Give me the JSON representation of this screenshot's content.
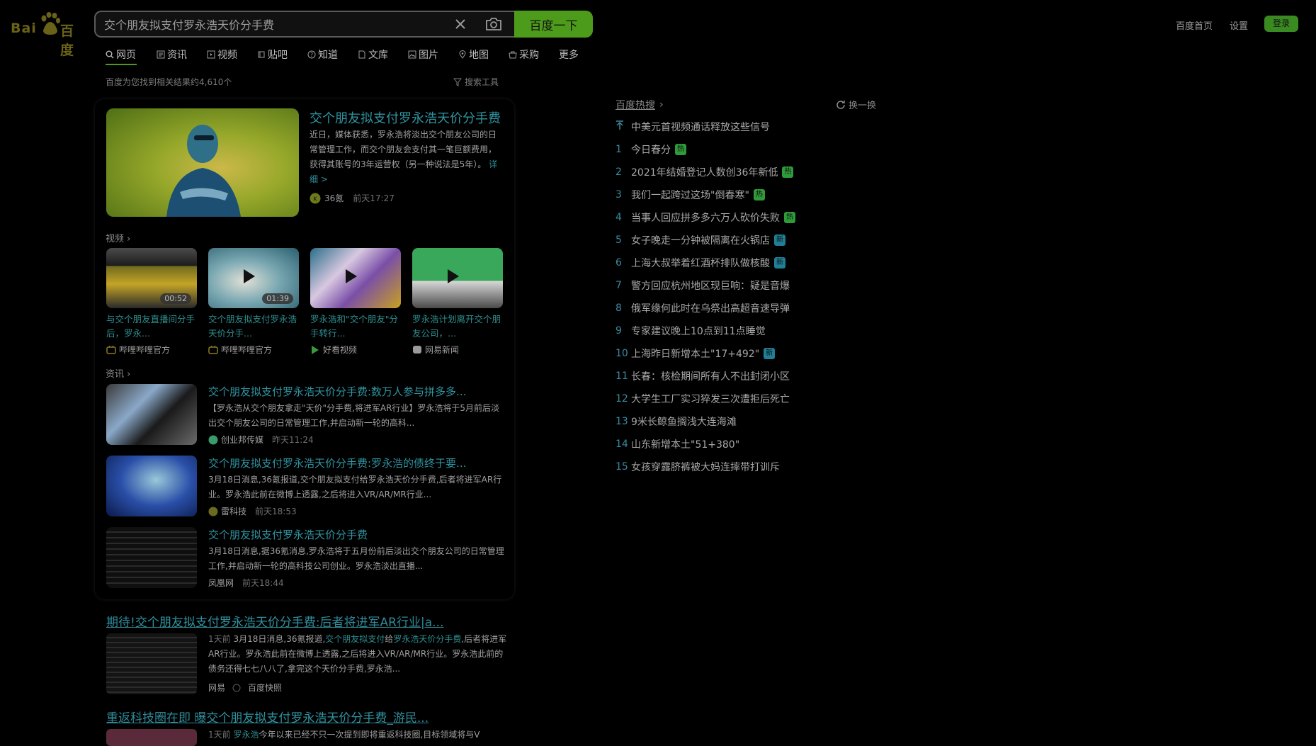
{
  "logo": {
    "text": "Bai",
    "text2": "百度"
  },
  "search": {
    "value": "交个朋友拟支付罗永浩天价分手费",
    "button_label": "百度一下"
  },
  "top_nav": {
    "home": "百度首页",
    "settings": "设置",
    "login": "登录"
  },
  "tabs": [
    {
      "label": "网页",
      "icon": "search-icon"
    },
    {
      "label": "资讯",
      "icon": "news-icon"
    },
    {
      "label": "视频",
      "icon": "video-icon"
    },
    {
      "label": "贴吧",
      "icon": "tieba-icon"
    },
    {
      "label": "知道",
      "icon": "question-icon"
    },
    {
      "label": "文库",
      "icon": "document-icon"
    },
    {
      "label": "图片",
      "icon": "image-icon"
    },
    {
      "label": "地图",
      "icon": "map-pin-icon"
    },
    {
      "label": "采购",
      "icon": "shop-icon"
    },
    {
      "label": "更多",
      "icon": ""
    }
  ],
  "result_count": "百度为您找到相关结果约4,610个",
  "search_tools": "搜索工具",
  "featured": {
    "title": "交个朋友拟支付罗永浩天价分手费",
    "desc": "近日，媒体获悉，罗永浩将淡出交个朋友公司的日常管理工作，而交个朋友会支付其一笔巨额费用，获得其账号的3年运营权（另一种说法是5年）。",
    "more": "详细 >",
    "source": "36氪",
    "time": "前天17:27"
  },
  "video_section": "视频",
  "videos": [
    {
      "title": "与交个朋友直播间分手后，罗永...",
      "source": "哔哩哔哩官方",
      "duration": "00:52"
    },
    {
      "title": "交个朋友拟支付罗永浩天价分手...",
      "source": "哔哩哔哩官方",
      "duration": "01:39"
    },
    {
      "title": "罗永浩和\"交个朋友\"分手转行...",
      "source": "好看视频",
      "duration": ""
    },
    {
      "title": "罗永浩计划离开交个朋友公司，...",
      "source": "网易新闻",
      "duration": ""
    }
  ],
  "news_section": "资讯",
  "news": [
    {
      "title": "交个朋友拟支付罗永浩天价分手费:数万人参与拼多多...",
      "desc": "【罗永浩从交个朋友拿走\"天价\"分手费,将进军AR行业】罗永浩将于5月前后淡出交个朋友公司的日常管理工作,并启动新一轮的高科...",
      "source": "创业邦传媒",
      "time": "昨天11:24"
    },
    {
      "title": "交个朋友拟支付罗永浩天价分手费:罗永浩的债终于要...",
      "desc": "3月18日消息,36氪报道,交个朋友拟支付给罗永浩天价分手费,后者将进军AR行业。罗永浩此前在微博上透露,之后将进入VR/AR/MR行业...",
      "source": "雷科技",
      "time": "前天18:53"
    },
    {
      "title": "交个朋友拟支付罗永浩天价分手费",
      "desc": "3月18日消息,据36氪消息,罗永浩将于五月份前后淡出交个朋友公司的日常管理工作,并启动新一轮的高科技公司创业。罗永浩淡出直播...",
      "source": "凤凰网",
      "time": "前天18:44"
    }
  ],
  "organic": [
    {
      "title_pre": "期待!",
      "title_hl": "交个朋友拟支付罗永浩天价分手费",
      "title_post": ":后者将进军AR行业|a...",
      "time": "1天前",
      "desc_pre": "3月18日消息,36氪报道,",
      "desc_hl1": "交个朋友拟支付",
      "desc_mid": "给",
      "desc_hl2": "罗永浩天价分手费",
      "desc_post": ",后者将进军AR行业。罗永浩此前在微博上透露,之后将进入VR/AR/MR行业。罗永浩此前的债务还得七七八八了,拿完这个天价分手费,罗永浩...",
      "source": "网易",
      "cache": "百度快照"
    },
    {
      "title_pre": "重返科技圈在即 曝",
      "title_hl": "交个朋友拟支付罗永浩天价分手费",
      "title_post": "_游民...",
      "time": "1天前",
      "desc_pre": "",
      "desc_hl1": "罗永浩",
      "desc_mid": "",
      "desc_hl2": "",
      "desc_post": "今年以来已经不只一次提到即将重返科技圈,目标领域将与V",
      "source": "",
      "cache": ""
    }
  ],
  "hot": {
    "title": "百度热搜",
    "refresh": "换一换",
    "pinned": "中美元首视频通话释放这些信号",
    "items": [
      {
        "rank": "1",
        "text": "今日春分",
        "badge": "热",
        "badge_color": "#2f9a3a"
      },
      {
        "rank": "2",
        "text": "2021年结婚登记人数创36年新低",
        "badge": "热",
        "badge_color": "#2f9a3a"
      },
      {
        "rank": "3",
        "text": "我们一起跨过这场\"倒春寒\"",
        "badge": "热",
        "badge_color": "#2f9a3a"
      },
      {
        "rank": "4",
        "text": "当事人回应拼多多六万人砍价失败",
        "badge": "热",
        "badge_color": "#2f9a3a"
      },
      {
        "rank": "5",
        "text": "女子晚走一分钟被隔离在火锅店",
        "badge": "新",
        "badge_color": "#1f7f96"
      },
      {
        "rank": "6",
        "text": "上海大叔举着红酒杯排队做核酸",
        "badge": "新",
        "badge_color": "#1f7f96"
      },
      {
        "rank": "7",
        "text": "警方回应杭州地区现巨响：疑是音爆",
        "badge": "",
        "badge_color": ""
      },
      {
        "rank": "8",
        "text": "俄军缘何此时在乌祭出高超音速导弹",
        "badge": "",
        "badge_color": ""
      },
      {
        "rank": "9",
        "text": "专家建议晚上10点到11点睡觉",
        "badge": "",
        "badge_color": ""
      },
      {
        "rank": "10",
        "text": "上海昨日新增本土\"17+492\"",
        "badge": "新",
        "badge_color": "#1f7f96"
      },
      {
        "rank": "11",
        "text": "长春：核检期间所有人不出封闭小区",
        "badge": "",
        "badge_color": ""
      },
      {
        "rank": "12",
        "text": "大学生工厂实习猝发三次遭拒后死亡",
        "badge": "",
        "badge_color": ""
      },
      {
        "rank": "13",
        "text": "9米长鲸鱼搁浅大连海滩",
        "badge": "",
        "badge_color": ""
      },
      {
        "rank": "14",
        "text": "山东新增本土\"51+380\"",
        "badge": "",
        "badge_color": ""
      },
      {
        "rank": "15",
        "text": "女孩穿露脐裤被大妈连摔带打训斥",
        "badge": "",
        "badge_color": ""
      }
    ]
  },
  "colors": {
    "accent": "#4d9b1a",
    "link": "#2f94a0",
    "background": "#000000"
  }
}
